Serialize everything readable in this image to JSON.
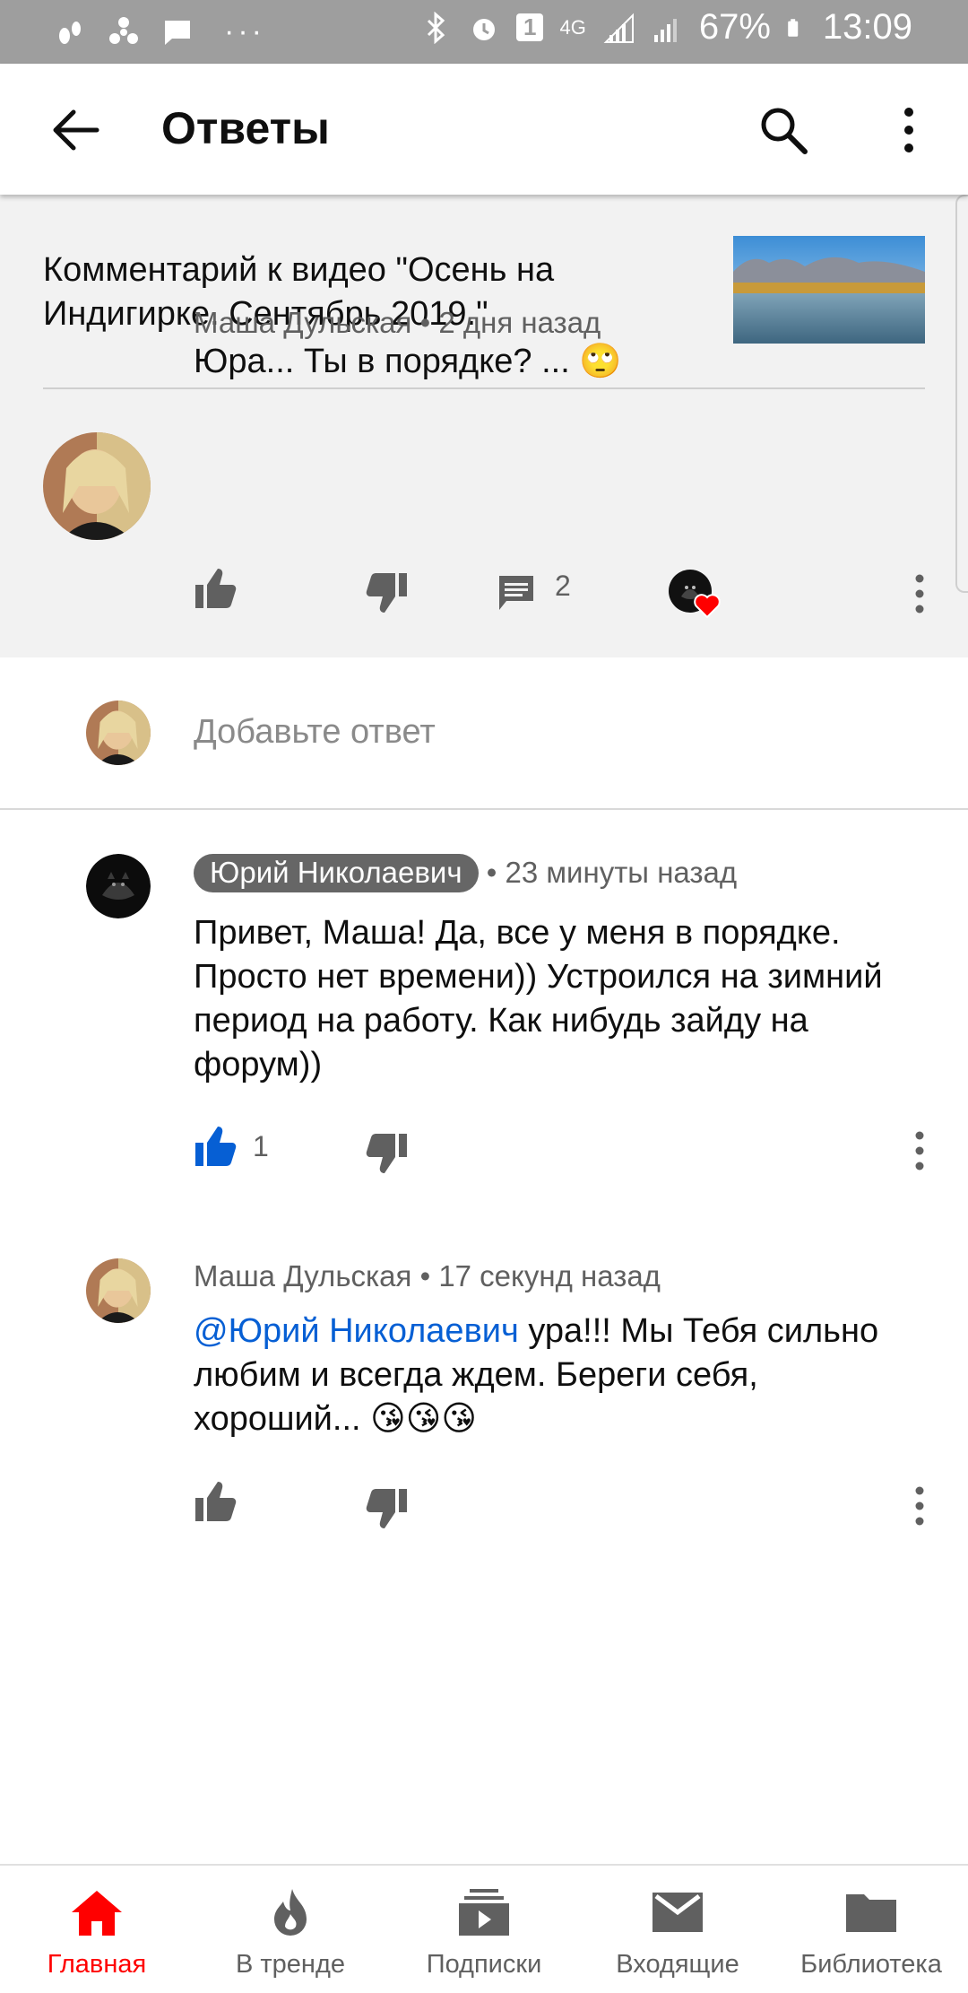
{
  "status_bar": {
    "battery": "67%",
    "time": "13:09",
    "network": "4G",
    "sim_badge": "1"
  },
  "app_bar": {
    "title": "Ответы"
  },
  "header": {
    "video_caption": "Комментарий к видео \"Осень на Индигирке. Сентябрь 2019.\""
  },
  "parent_comment": {
    "author": "Маша Дульская",
    "time": "2 дня назад",
    "text": "Юра... Ты в порядке? ... 🙄",
    "reply_count": "2"
  },
  "add_reply": {
    "placeholder": "Добавьте ответ"
  },
  "replies": [
    {
      "author": "Юрий Николаевич",
      "time": "23 минуты назад",
      "text": "Привет, Маша! Да, все у меня в порядке. Просто нет времени)) Устроился на зимний период на работу. Как нибудь зайду на форум))",
      "likes": "1"
    },
    {
      "author": "Маша Дульская",
      "time": "17 секунд назад",
      "mention": "@Юрий Николаевич",
      "text": " ура!!! Мы Тебя сильно любим и всегда ждем. Береги себя, хороший... 😘😘😘"
    }
  ],
  "bottom_nav": {
    "home": "Главная",
    "trending": "В тренде",
    "subscriptions": "Подписки",
    "inbox": "Входящие",
    "library": "Библиотека"
  },
  "colors": {
    "accent_red": "#ff0000",
    "like_blue": "#065fd4",
    "header_bg": "#f2f2f2",
    "status_bar_bg": "#9e9e9e"
  }
}
